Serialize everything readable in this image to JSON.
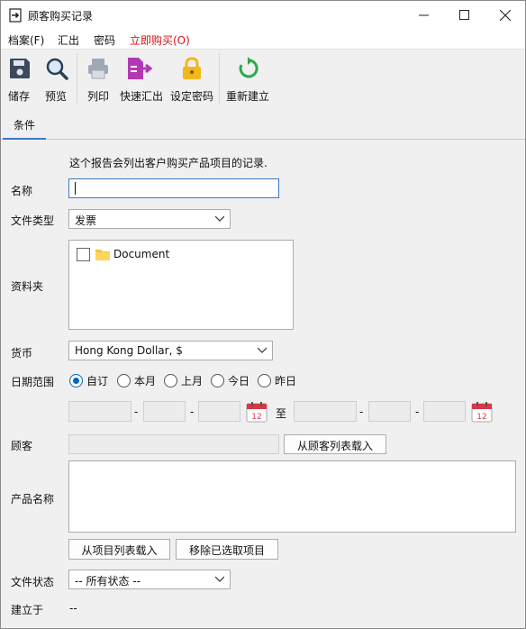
{
  "window": {
    "title": "顾客购买记录",
    "controls": {
      "minimize": "minimize",
      "maximize": "maximize",
      "close": "close"
    }
  },
  "menu": [
    {
      "label": "档案(F)"
    },
    {
      "label": "汇出"
    },
    {
      "label": "密码"
    },
    {
      "label": "立即购买(O)",
      "color": "#dd1111"
    }
  ],
  "toolbar": {
    "save": "储存",
    "preview": "预览",
    "print": "列印",
    "quick_export": "快速汇出",
    "set_password": "设定密码",
    "rebuild": "重新建立"
  },
  "tabs": [
    {
      "label": "条件",
      "active": true
    }
  ],
  "form": {
    "description": "这个报告会列出客户购买产品项目的记录.",
    "name_label": "名称",
    "name_value": "",
    "doc_type_label": "文件类型",
    "doc_type_value": "发票",
    "folder_label": "资料夹",
    "folder_item": "Document",
    "folder_checked": false,
    "currency_label": "货币",
    "currency_value": "Hong Kong Dollar, $",
    "date_range_label": "日期范围",
    "date_options": [
      "自订",
      "本月",
      "上月",
      "今日",
      "昨日"
    ],
    "date_selected": "自订",
    "date_to": "至",
    "customer_label": "顾客",
    "customer_value": "",
    "load_customer_button": "从顾客列表载入",
    "product_label": "产品名称",
    "load_items_button": "从项目列表载入",
    "remove_selected_button": "移除已选取项目",
    "doc_status_label": "文件状态",
    "doc_status_value": "-- 所有状态 --",
    "created_label": "建立于",
    "created_value": "--",
    "calendar_day": "12"
  },
  "colors": {
    "accent": "#3a78c8",
    "radio": "#0067c0",
    "menu_red": "#dd1111",
    "save_icon": "#3b4a5c",
    "export_icon": "#b239b5",
    "lock_icon": "#f2b71d",
    "rebuild_icon": "#2ea84a",
    "calendar_icon": "#d9384a"
  }
}
